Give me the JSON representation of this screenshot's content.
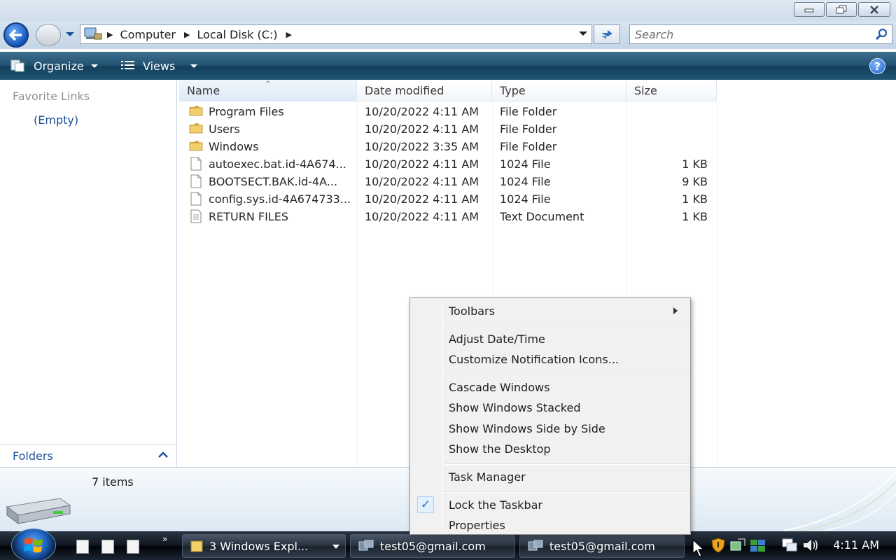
{
  "address": {
    "crumbs": [
      "Computer",
      "Local Disk (C:)"
    ],
    "search_placeholder": "Search"
  },
  "commandbar": {
    "organize_label": "Organize",
    "views_label": "Views",
    "help_label": "?"
  },
  "navpane": {
    "favorite_links": "Favorite Links",
    "empty": "(Empty)",
    "folders": "Folders"
  },
  "filelist": {
    "columns": [
      "Name",
      "Date modified",
      "Type",
      "Size"
    ],
    "rows": [
      {
        "name": "Program Files",
        "date": "10/20/2022 4:11 AM",
        "type": "File Folder",
        "size": "",
        "icon": "folder-icon"
      },
      {
        "name": "Users",
        "date": "10/20/2022 4:11 AM",
        "type": "File Folder",
        "size": "",
        "icon": "folder-icon"
      },
      {
        "name": "Windows",
        "date": "10/20/2022 3:35 AM",
        "type": "File Folder",
        "size": "",
        "icon": "folder-icon"
      },
      {
        "name": "autoexec.bat.id-4A674...",
        "date": "10/20/2022 4:11 AM",
        "type": "1024 File",
        "size": "1 KB",
        "icon": "file-icon"
      },
      {
        "name": "BOOTSECT.BAK.id-4A...",
        "date": "10/20/2022 4:11 AM",
        "type": "1024 File",
        "size": "9 KB",
        "icon": "file-icon"
      },
      {
        "name": "config.sys.id-4A674733...",
        "date": "10/20/2022 4:11 AM",
        "type": "1024 File",
        "size": "1 KB",
        "icon": "file-icon"
      },
      {
        "name": "RETURN FILES",
        "date": "10/20/2022 4:11 AM",
        "type": "Text Document",
        "size": "1 KB",
        "icon": "text-file-icon"
      }
    ]
  },
  "details": {
    "item_count": "7 items"
  },
  "context_menu": {
    "items": [
      {
        "label": "Toolbars"
      },
      {
        "label": "Adjust Date/Time"
      },
      {
        "label": "Customize Notification Icons..."
      },
      {
        "label": "Cascade Windows"
      },
      {
        "label": "Show Windows Stacked"
      },
      {
        "label": "Show Windows Side by Side"
      },
      {
        "label": "Show the Desktop"
      },
      {
        "label": "Task Manager"
      },
      {
        "label": "Lock the Taskbar"
      },
      {
        "label": "Properties"
      }
    ],
    "checked_item": "Lock the Taskbar"
  },
  "taskbar": {
    "more": "»",
    "buttons": [
      {
        "label": "3 Windows Expl..."
      },
      {
        "label": "test05@gmail.com"
      },
      {
        "label": "test05@gmail.com"
      }
    ],
    "clock": "4:11 AM"
  }
}
